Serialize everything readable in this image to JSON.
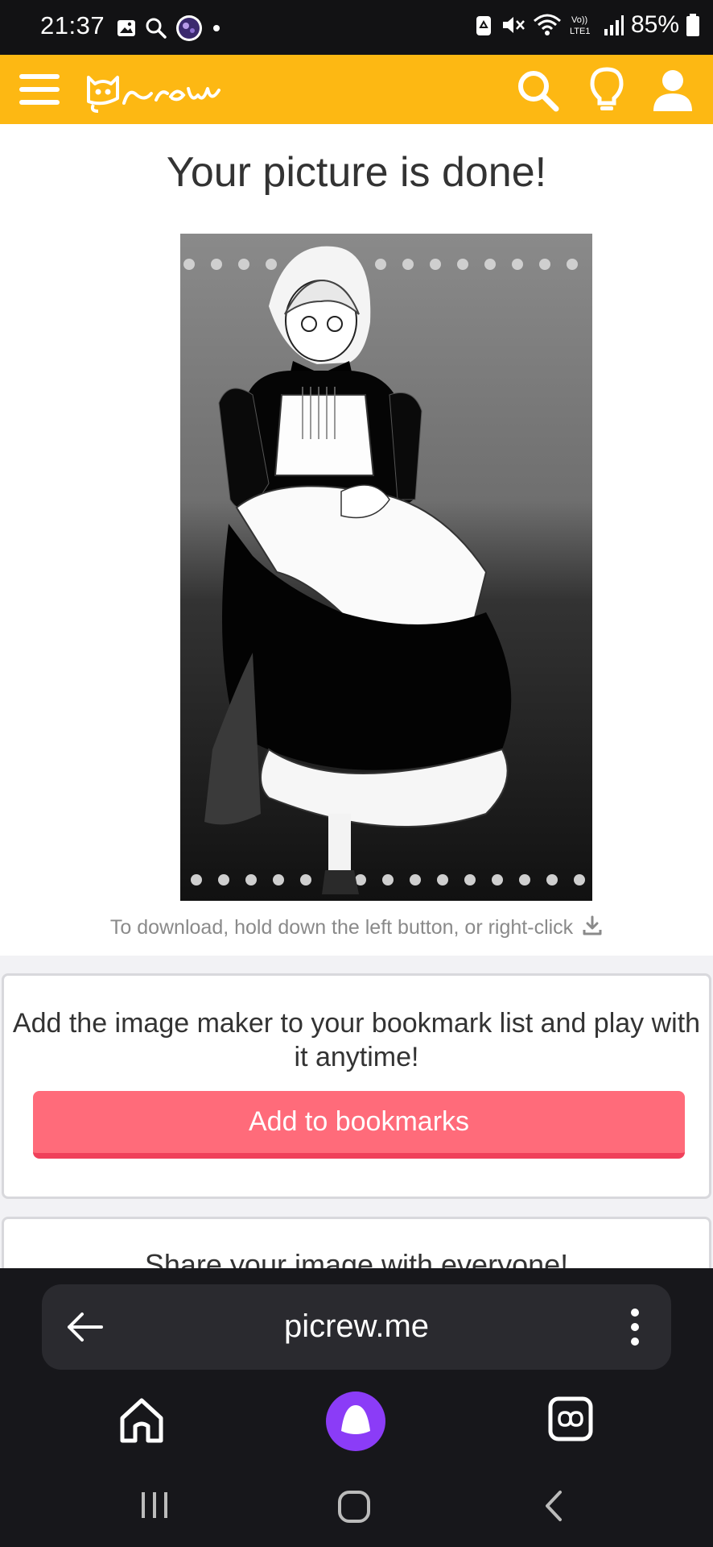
{
  "status_bar": {
    "time": "21:37",
    "battery": "85%",
    "icons_left": [
      "gallery-icon",
      "search-icon",
      "app-avatar-icon",
      "dot-icon"
    ],
    "icons_right": [
      "recycle-icon",
      "mute-icon",
      "wifi-icon",
      "volte-icon",
      "signal-icon",
      "battery-icon"
    ]
  },
  "header": {
    "logo_text": "Picrew",
    "icons": [
      "menu-icon",
      "search-icon",
      "lightbulb-icon",
      "user-icon"
    ],
    "color": "#FDB813"
  },
  "main": {
    "title": "Your picture is done!",
    "picture_alt": "Monochrome illustration of a seated maid character",
    "download_hint": "To download, hold down the left button, or right-click",
    "download_icon": "download-icon"
  },
  "bookmark_card": {
    "text": "Add the image maker to your bookmark list and play with it anytime!",
    "button_label": "Add to bookmarks",
    "button_color": "#FF6B7A"
  },
  "share_card": {
    "text": "Share your image with everyone!"
  },
  "browser": {
    "url": "picrew.me",
    "icons": [
      "back-arrow-icon",
      "more-vertical-icon",
      "home-icon",
      "assistant-icon",
      "tabs-icon"
    ]
  },
  "system_nav": {
    "icons": [
      "recent-apps-icon",
      "home-circle-icon",
      "back-chevron-icon"
    ]
  }
}
